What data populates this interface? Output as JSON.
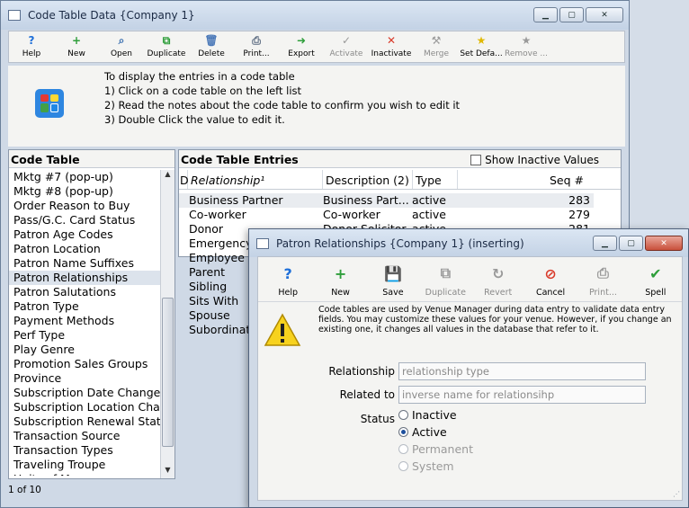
{
  "main": {
    "title": "Code Table Data {Company 1}",
    "toolbar": [
      {
        "label": "Help",
        "icon": "help-icon",
        "enabled": true
      },
      {
        "label": "New",
        "icon": "new-icon",
        "enabled": true
      },
      {
        "label": "Open",
        "icon": "open-icon",
        "enabled": true
      },
      {
        "label": "Duplicate",
        "icon": "duplicate-icon",
        "enabled": true
      },
      {
        "label": "Delete",
        "icon": "delete-icon",
        "enabled": true
      },
      {
        "label": "Print...",
        "icon": "print-icon",
        "enabled": true
      },
      {
        "label": "Export",
        "icon": "export-icon",
        "enabled": true
      },
      {
        "label": "Activate",
        "icon": "activate-icon",
        "enabled": false
      },
      {
        "label": "Inactivate",
        "icon": "inactivate-icon",
        "enabled": true
      },
      {
        "label": "Merge",
        "icon": "merge-icon",
        "enabled": false
      },
      {
        "label": "Set Defa...",
        "icon": "set-default-icon",
        "enabled": true
      },
      {
        "label": "Remove ...",
        "icon": "remove-default-icon",
        "enabled": false
      }
    ],
    "instructions": [
      "To display the entries in a code table",
      "1) Click on a code table on the left list",
      "2) Read the notes about the code table to confirm you wish to edit it",
      "3) Double Click the value to edit it."
    ],
    "left_panel": {
      "header": "Code Table",
      "items": [
        "Mktg #7 (pop-up)",
        "Mktg #8 (pop-up)",
        "Order Reason to Buy",
        "Pass/G.C. Card Status",
        "Patron Age Codes",
        "Patron Location",
        "Patron Name Suffixes",
        "Patron Relationships",
        "Patron Salutations",
        "Patron Type",
        "Payment Methods",
        "Perf Type",
        "Play Genre",
        "Promotion Sales Groups",
        "Province",
        "Subscription Date Change",
        "Subscription Location Cha",
        "Subscription Renewal Stat",
        "Transaction Source",
        "Transaction Types",
        "Traveling Troupe",
        "Units of Measure"
      ],
      "selected_index": 7,
      "status": "1 of 10"
    },
    "right_panel": {
      "header": "Code Table Entries",
      "show_inactive_label": "Show Inactive Values",
      "columns": [
        "D",
        "Relationship¹",
        "Description (2)",
        "Type",
        "Seq #"
      ],
      "rows": [
        {
          "rel": "Business Partner",
          "desc": "Business Part...",
          "type": "active",
          "seq": "283"
        },
        {
          "rel": "Co-worker",
          "desc": "Co-worker",
          "type": "active",
          "seq": "279"
        },
        {
          "rel": "Donor",
          "desc": "Donor Solicitor",
          "type": "active",
          "seq": "281"
        },
        {
          "rel": "Emergency",
          "desc": "",
          "type": "",
          "seq": ""
        },
        {
          "rel": "Employee",
          "desc": "",
          "type": "",
          "seq": ""
        },
        {
          "rel": "Parent",
          "desc": "",
          "type": "",
          "seq": ""
        },
        {
          "rel": "Sibling",
          "desc": "",
          "type": "",
          "seq": ""
        },
        {
          "rel": "Sits With",
          "desc": "",
          "type": "",
          "seq": ""
        },
        {
          "rel": "Spouse",
          "desc": "",
          "type": "",
          "seq": ""
        },
        {
          "rel": "Subordinat",
          "desc": "",
          "type": "",
          "seq": ""
        }
      ]
    }
  },
  "dialog": {
    "title": "Patron Relationships {Company 1} (inserting)",
    "toolbar": [
      {
        "label": "Help",
        "icon": "help-icon",
        "enabled": true
      },
      {
        "label": "New",
        "icon": "new-icon",
        "enabled": true
      },
      {
        "label": "Save",
        "icon": "save-icon",
        "enabled": true
      },
      {
        "label": "Duplicate",
        "icon": "duplicate-icon",
        "enabled": false
      },
      {
        "label": "Revert",
        "icon": "revert-icon",
        "enabled": false
      },
      {
        "label": "Cancel",
        "icon": "cancel-icon",
        "enabled": true
      },
      {
        "label": "Print...",
        "icon": "print-icon",
        "enabled": false
      },
      {
        "label": "Spell",
        "icon": "spell-icon",
        "enabled": true
      }
    ],
    "note": "Code tables are used by Venue Manager during data entry to validate data entry fields.  You may customize these values for your venue.  However, if you change an existing one, it changes all values in the database that refer to it.",
    "relationship_label": "Relationship",
    "relationship_placeholder": "relationship type",
    "related_to_label": "Related to",
    "related_to_placeholder": "inverse name for relationsihp",
    "status_label": "Status",
    "status_options": [
      {
        "label": "Inactive",
        "selected": false,
        "enabled": true
      },
      {
        "label": "Active",
        "selected": true,
        "enabled": true
      },
      {
        "label": "Permanent",
        "selected": false,
        "enabled": false
      },
      {
        "label": "System",
        "selected": false,
        "enabled": false
      }
    ]
  }
}
